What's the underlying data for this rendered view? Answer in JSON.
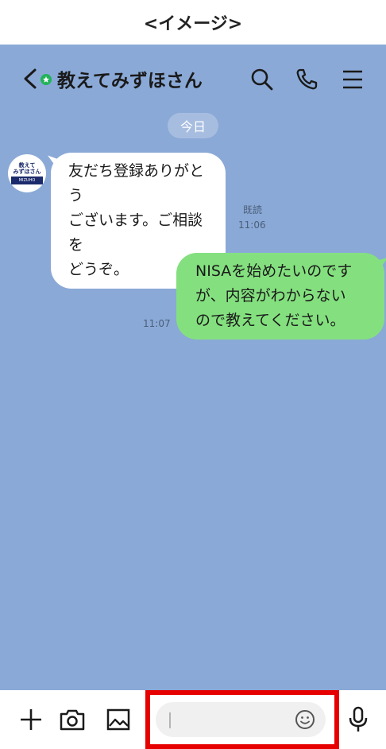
{
  "caption": "<イメージ>",
  "header": {
    "title": "教えてみずほさん",
    "icons": [
      "back-chevron-icon",
      "verified-dot-icon",
      "search-icon",
      "phone-icon",
      "menu-icon"
    ]
  },
  "chat": {
    "date_label": "今日",
    "avatar": {
      "line1": "教えて",
      "line2": "みずほさん",
      "brand": "MIZUHO"
    },
    "messages": [
      {
        "direction": "in",
        "text": "友だち登録ありがとう\nございます。ご相談を\nどうぞ。",
        "read": "既読",
        "time": "11:06"
      },
      {
        "direction": "out",
        "text": "NISAを始めたいのです\nが、内容がわからない\nので教えてください。",
        "time": "11:07"
      }
    ]
  },
  "input_bar": {
    "placeholder": "",
    "icons": [
      "plus-icon",
      "camera-icon",
      "image-icon",
      "emoji-icon",
      "microphone-icon"
    ]
  },
  "colors": {
    "chat_bg": "#8aa9d6",
    "outgoing_bubble": "#84e07f",
    "highlight": "#e60000"
  }
}
